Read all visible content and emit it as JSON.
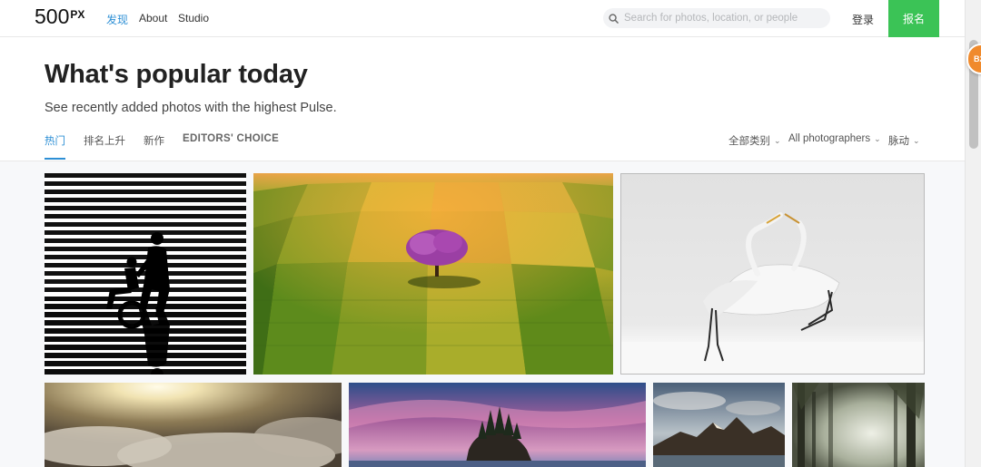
{
  "header": {
    "logo": {
      "number": "500",
      "suffix": "PX"
    },
    "nav": {
      "discover": "发现",
      "about": "About",
      "studio": "Studio"
    },
    "search": {
      "placeholder": "Search for photos, location, or people",
      "icon": "search-icon"
    },
    "login": "登录",
    "signup": "报名"
  },
  "hero": {
    "title": "What's popular today",
    "subtitle": "See recently added photos with the highest Pulse.",
    "tabs": [
      {
        "label": "热门",
        "active": true
      },
      {
        "label": "排名上升",
        "active": false
      },
      {
        "label": "新作",
        "active": false
      },
      {
        "label": "EDITORS' CHOICE",
        "active": false
      }
    ],
    "filters": {
      "category": "全部类别",
      "photographers": "All photographers",
      "sort": "脉动"
    }
  },
  "float_badge": "B2",
  "colors": {
    "accent": "#2d8fd5",
    "signup": "#3bc356",
    "badge": "#f08a2c"
  },
  "photos": [
    {
      "subject": "striped silhouette family"
    },
    {
      "subject": "purple tree in fields"
    },
    {
      "subject": "white egrets in snow"
    },
    {
      "subject": "sun above clouds"
    },
    {
      "subject": "sea stack at dusk"
    },
    {
      "subject": "mountain lake"
    },
    {
      "subject": "misty forest"
    }
  ]
}
